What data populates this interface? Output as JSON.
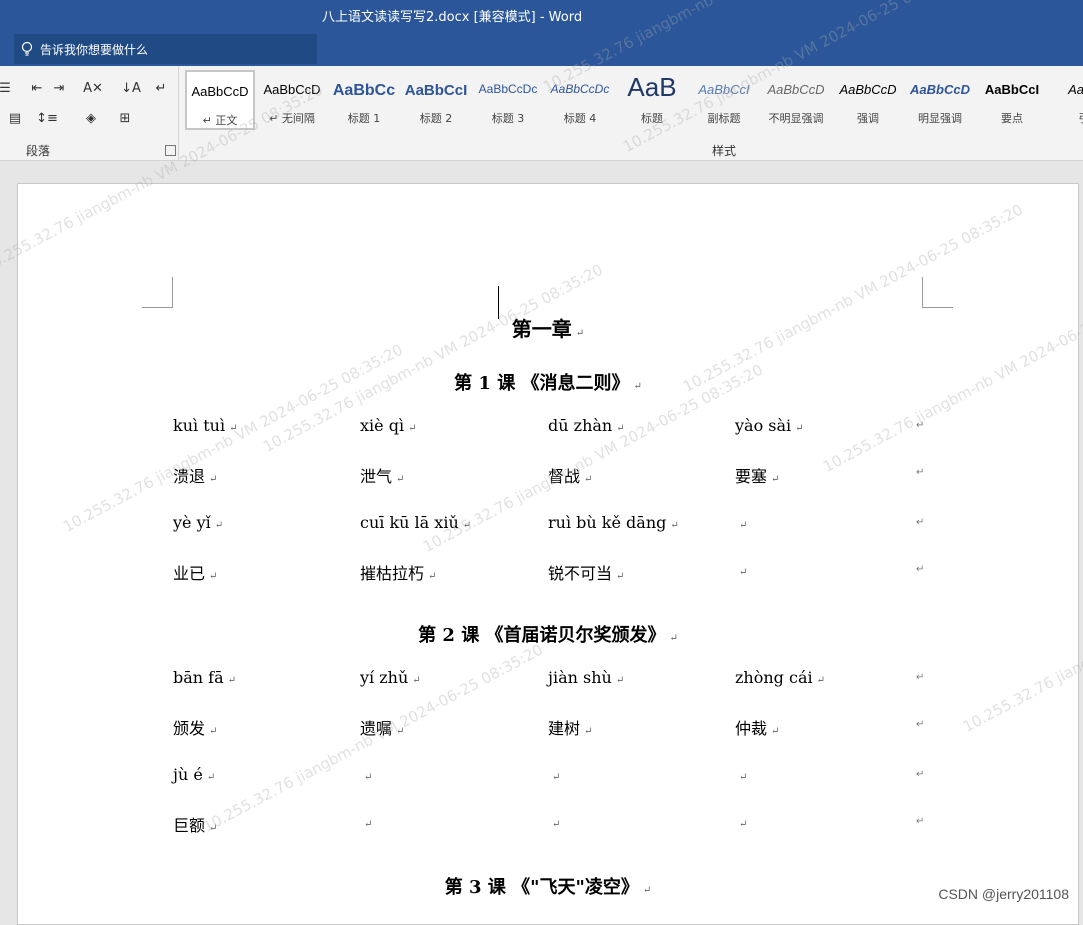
{
  "titlebar": {
    "title": "八上语文读读写写2.docx [兼容模式]  -  Word",
    "tell_me": "告诉我你想要做什么"
  },
  "ribbon": {
    "paragraph_group_label": "段落",
    "styles_group_label": "样式",
    "styles": [
      {
        "sample": "AaBbCcD",
        "name": "↵ 正文",
        "color": "#000000"
      },
      {
        "sample": "AaBbCcD",
        "name": "↵ 无间隔",
        "color": "#000000"
      },
      {
        "sample": "AaBbCc",
        "name": "标题 1",
        "color": "#2e5597"
      },
      {
        "sample": "AaBbCcI",
        "name": "标题 2",
        "color": "#2e5597"
      },
      {
        "sample": "AaBbCcDc",
        "name": "标题 3",
        "color": "#2e5597"
      },
      {
        "sample": "AaBbCcDc",
        "name": "标题 4",
        "color": "#2e5597"
      },
      {
        "sample": "AaB",
        "name": "标题",
        "color": "#1f3864"
      },
      {
        "sample": "AaBbCcI",
        "name": "副标题",
        "color": "#5a7bb5"
      },
      {
        "sample": "AaBbCcD",
        "name": "不明显强调",
        "color": "#666666"
      },
      {
        "sample": "AaBbCcD",
        "name": "强调",
        "color": "#000000"
      },
      {
        "sample": "AaBbCcD",
        "name": "明显强调",
        "color": "#2e5597"
      },
      {
        "sample": "AaBbCcI",
        "name": "要点",
        "color": "#000000"
      },
      {
        "sample": "AaBb",
        "name": "引",
        "color": "#000000"
      }
    ]
  },
  "document": {
    "chapter_title": "第一章",
    "lessons": [
      {
        "heading": "第 1 课 《消息二则》",
        "rows": [
          [
            "kuì tuì",
            "xiè qì",
            "dū zhàn",
            "yào sài"
          ],
          [
            "溃退",
            "泄气",
            "督战",
            "要塞"
          ],
          [
            "yè yǐ",
            "cuī kū lā xiǔ",
            "ruì bù kě dāng",
            ""
          ],
          [
            "业已",
            "摧枯拉朽",
            "锐不可当",
            ""
          ]
        ]
      },
      {
        "heading": "第 2 课 《首届诺贝尔奖颁发》",
        "rows": [
          [
            "bān fā",
            "yí zhǔ",
            "jiàn shù",
            "zhòng cái"
          ],
          [
            "颁发",
            "遗嘱",
            "建树",
            "仲裁"
          ],
          [
            "jù é",
            "",
            "",
            ""
          ],
          [
            "巨额",
            "",
            "",
            ""
          ]
        ]
      },
      {
        "heading": "第 3 课 《\"飞天\"凌空》",
        "rows": []
      }
    ]
  },
  "overlay": {
    "watermark": "10.255.32.76 jiangbm-nb VM 2024-06-25 08:35:20",
    "credit": "CSDN @jerry201108"
  }
}
